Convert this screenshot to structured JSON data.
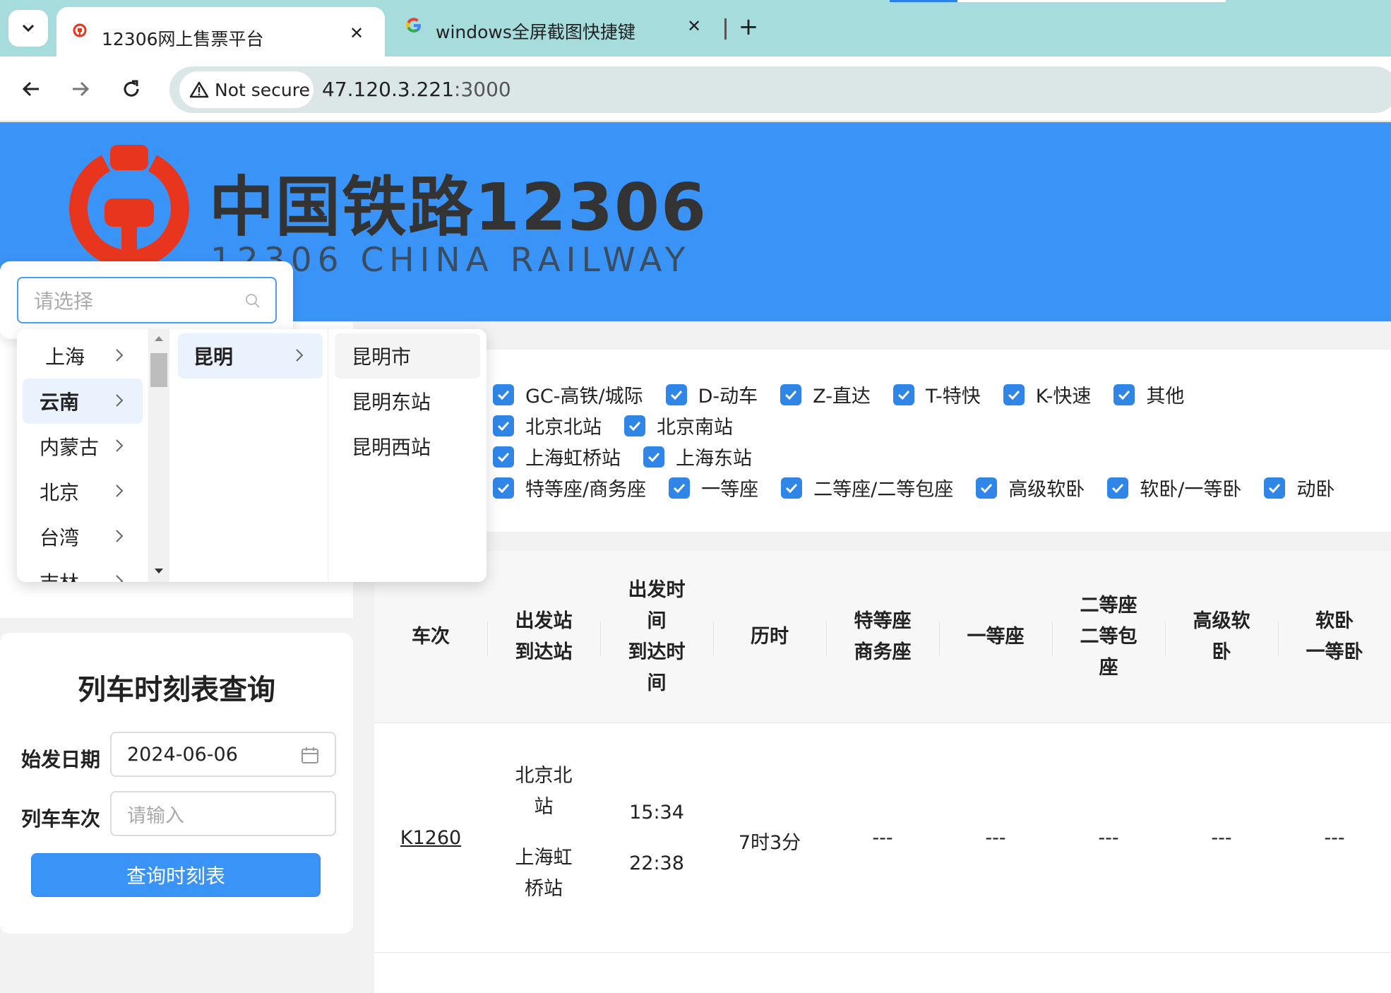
{
  "browser": {
    "tabs": [
      {
        "title": "12306网上售票平台",
        "active": true
      },
      {
        "title": "windows全屏截图快捷键 - Goo",
        "active": false
      }
    ],
    "security_label": "Not secure",
    "url_host": "47.120.3.221",
    "url_port": ":3000"
  },
  "header": {
    "title": "中国铁路12306",
    "subtitle": "12306 CHINA RAILWAY",
    "logo_color": "#e8361e"
  },
  "cascader": {
    "placeholder": "请选择",
    "level1": [
      "上海",
      "云南",
      "内蒙古",
      "北京",
      "台湾",
      "吉林"
    ],
    "level1_selected": "云南",
    "level2": [
      "昆明"
    ],
    "level2_selected": "昆明",
    "level3": [
      "昆明市",
      "昆明东站",
      "昆明西站"
    ]
  },
  "query": {
    "title": "列车时刻表查询",
    "date_label": "始发日期",
    "date_value": "2024-06-06",
    "train_label": "列车车次",
    "train_placeholder": "请输入",
    "button": "查询时刻表"
  },
  "filters": {
    "train_types": [
      "GC-高铁/城际",
      "D-动车",
      "Z-直达",
      "T-特快",
      "K-快速",
      "其他"
    ],
    "from_stations": [
      "北京北站",
      "北京南站"
    ],
    "to_stations": [
      "上海虹桥站",
      "上海东站"
    ],
    "seat_types": [
      "特等座/商务座",
      "一等座",
      "二等座/二等包座",
      "高级软卧",
      "软卧/一等卧",
      "动卧"
    ]
  },
  "table": {
    "headers": {
      "train": "车次",
      "stations_a": "出发站",
      "stations_b": "到达站",
      "time_a": "出发时",
      "time_b": "间",
      "time_c": "到达时",
      "time_d": "间",
      "duration": "历时",
      "business_a": "特等座",
      "business_b": "商务座",
      "first": "一等座",
      "second_a": "二等座",
      "second_b": "二等包",
      "second_c": "座",
      "soft_a": "高级软",
      "soft_b": "卧",
      "sleeper_a": "软卧",
      "sleeper_b": "一等卧"
    },
    "rows": [
      {
        "train": "K1260",
        "from_a": "北京北",
        "from_b": "站",
        "to_a": "上海虹",
        "to_b": "桥站",
        "depart": "15:34",
        "arrive": "22:38",
        "duration": "7时3分",
        "business": "---",
        "first": "---",
        "second": "---",
        "soft": "---",
        "sleeper": "---"
      }
    ]
  }
}
